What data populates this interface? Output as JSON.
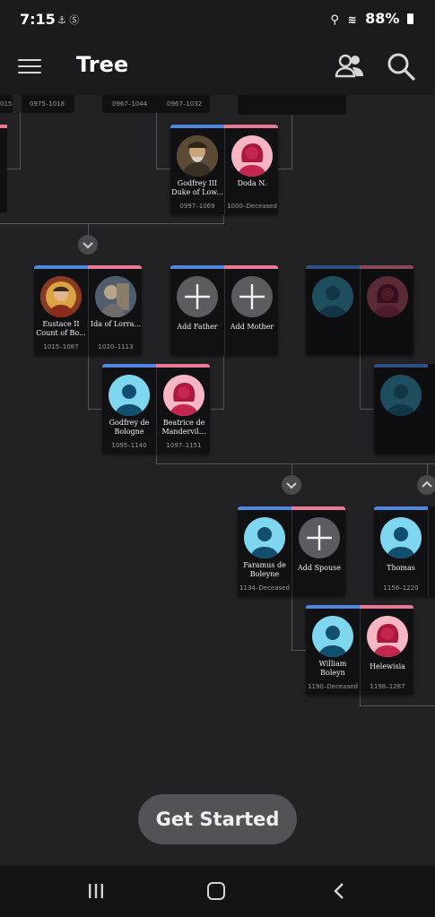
{
  "status": {
    "time": "7:15",
    "battery": "88%",
    "left_icons": "⚓ Ⓢ"
  },
  "header": {
    "title": "Tree"
  },
  "top_partial": {
    "d1": "015",
    "d2": "0975–1018",
    "d3": "0967–1044",
    "d4": "0967–1032"
  },
  "cards": {
    "godfrey3": {
      "name": "Godfrey III Duke of Low...",
      "dates": "0997–1069"
    },
    "doda": {
      "name": "Doda N.",
      "dates": "1000–Deceased"
    },
    "eustace": {
      "name": "Eustace II Count of Bo...",
      "dates": "1015–1087"
    },
    "ida": {
      "name": "Ida of Lorra...",
      "dates": "1020–1113"
    },
    "add_father": {
      "name": "Add Father"
    },
    "add_mother": {
      "name": "Add Mother"
    },
    "godfrey_b": {
      "name": "Godfrey de Bologne",
      "dates": "1095–1140"
    },
    "beatrice": {
      "name": "Beatrice de Mandervil...",
      "dates": "1097–1151"
    },
    "faramus": {
      "name": "Faramus de Boleyne",
      "dates": "1134–Deceased"
    },
    "add_spouse": {
      "name": "Add Spouse"
    },
    "thomas": {
      "name": "Thomas",
      "dates": "1156–1220"
    },
    "william": {
      "name": "William Boleyn",
      "dates": "1190–Deceased"
    },
    "helewisia": {
      "name": "Helewisia",
      "dates": "1198–1287"
    }
  },
  "cta": {
    "label": "Get Started"
  },
  "colors": {
    "male_bar": "#4f86e0",
    "female_bar": "#e97994",
    "male_avatar": "#7ed7ef",
    "female_avatar": "#f6b6c3"
  }
}
